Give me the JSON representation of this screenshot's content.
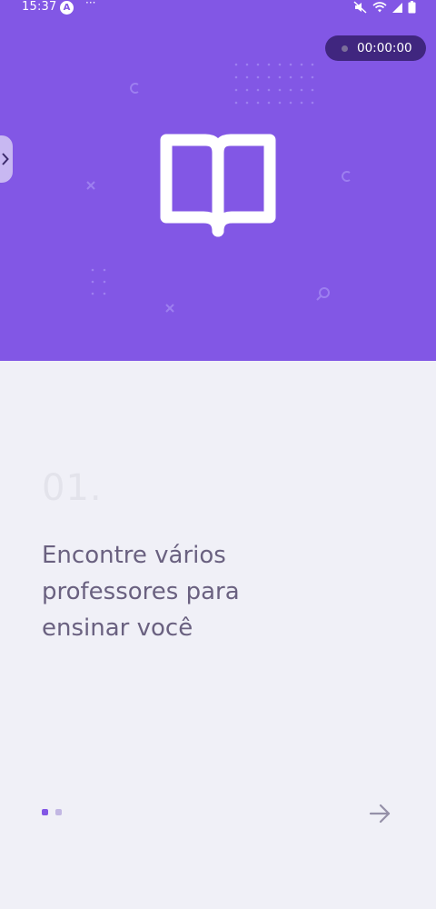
{
  "status_bar": {
    "time": "15:37",
    "app_icon_letter": "A",
    "extra": "···",
    "icons": [
      "mute-icon",
      "wifi-icon",
      "signal-icon",
      "battery-icon"
    ]
  },
  "recorder": {
    "time": "00:00:00"
  },
  "hero": {
    "icon": "book-open-icon",
    "background_color": "#8257e5"
  },
  "onboarding": {
    "step_number": "01.",
    "title_lines": [
      "Encontre vários",
      "professores para",
      "ensinar você"
    ],
    "pager": {
      "count": 2,
      "active_index": 0,
      "active_color": "#8257e5",
      "inactive_color": "#c2b7e3"
    },
    "next_icon": "arrow-right-icon"
  }
}
